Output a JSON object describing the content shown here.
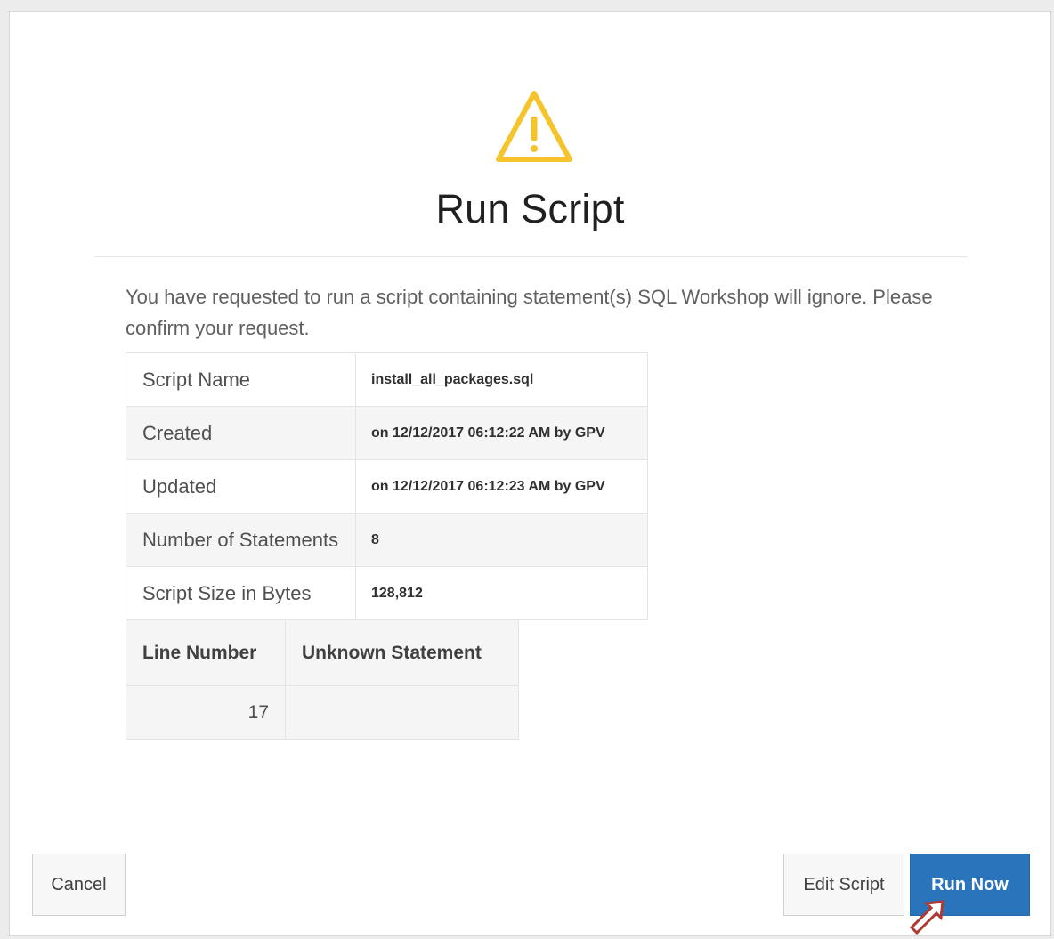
{
  "dialog": {
    "title": "Run Script",
    "icon": "warning-triangle-icon",
    "message": "You have requested to run a script containing statement(s) SQL Workshop will ignore. Please confirm your request."
  },
  "script_info": [
    {
      "label": "Script Name",
      "value": "install_all_packages.sql"
    },
    {
      "label": "Created",
      "value": "on 12/12/2017 06:12:22 AM by GPV"
    },
    {
      "label": "Updated",
      "value": "on 12/12/2017 06:12:23 AM by GPV"
    },
    {
      "label": "Number of Statements",
      "value": "8"
    },
    {
      "label": "Script Size in Bytes",
      "value": "128,812"
    }
  ],
  "statements_table": {
    "headers": [
      "Line Number",
      "Unknown Statement"
    ],
    "rows": [
      {
        "line": "17",
        "statement": ""
      }
    ]
  },
  "buttons": {
    "cancel": "Cancel",
    "edit_script": "Edit Script",
    "run_now": "Run Now"
  },
  "colors": {
    "warning": "#f5c32a",
    "primary_button": "#2a74bc",
    "annotation_arrow": "#b03a32"
  }
}
